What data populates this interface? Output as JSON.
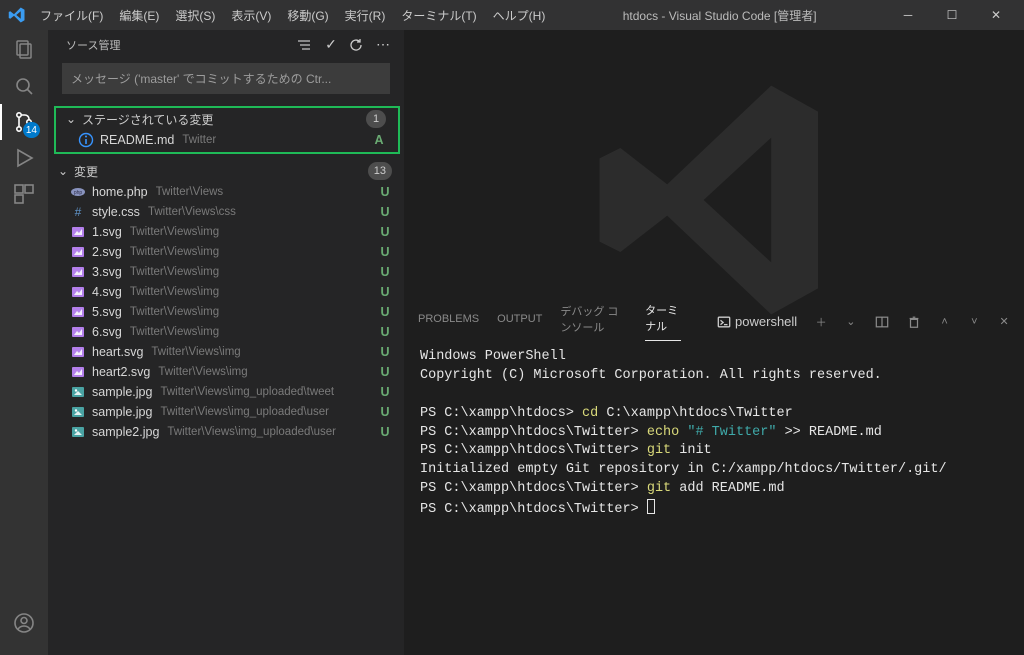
{
  "menubar": {
    "items": [
      "ファイル(F)",
      "編集(E)",
      "選択(S)",
      "表示(V)",
      "移動(G)",
      "実行(R)",
      "ターミナル(T)",
      "ヘルプ(H)"
    ],
    "title": "htdocs - Visual Studio Code [管理者]"
  },
  "activity": {
    "scm_badge": "14"
  },
  "scm": {
    "title": "ソース管理",
    "message_placeholder": "メッセージ ('master' でコミットするための Ctr...",
    "staged": {
      "label": "ステージされている変更",
      "count": "1",
      "files": [
        {
          "name": "README.md",
          "path": "Twitter",
          "status": "A",
          "icon": "info"
        }
      ]
    },
    "changes": {
      "label": "変更",
      "count": "13",
      "files": [
        {
          "name": "home.php",
          "path": "Twitter\\Views",
          "status": "U",
          "icon": "php"
        },
        {
          "name": "style.css",
          "path": "Twitter\\Views\\css",
          "status": "U",
          "icon": "css"
        },
        {
          "name": "1.svg",
          "path": "Twitter\\Views\\img",
          "status": "U",
          "icon": "svg"
        },
        {
          "name": "2.svg",
          "path": "Twitter\\Views\\img",
          "status": "U",
          "icon": "svg"
        },
        {
          "name": "3.svg",
          "path": "Twitter\\Views\\img",
          "status": "U",
          "icon": "svg"
        },
        {
          "name": "4.svg",
          "path": "Twitter\\Views\\img",
          "status": "U",
          "icon": "svg"
        },
        {
          "name": "5.svg",
          "path": "Twitter\\Views\\img",
          "status": "U",
          "icon": "svg"
        },
        {
          "name": "6.svg",
          "path": "Twitter\\Views\\img",
          "status": "U",
          "icon": "svg"
        },
        {
          "name": "heart.svg",
          "path": "Twitter\\Views\\img",
          "status": "U",
          "icon": "svg"
        },
        {
          "name": "heart2.svg",
          "path": "Twitter\\Views\\img",
          "status": "U",
          "icon": "svg"
        },
        {
          "name": "sample.jpg",
          "path": "Twitter\\Views\\img_uploaded\\tweet",
          "status": "U",
          "icon": "img"
        },
        {
          "name": "sample.jpg",
          "path": "Twitter\\Views\\img_uploaded\\user",
          "status": "U",
          "icon": "img"
        },
        {
          "name": "sample2.jpg",
          "path": "Twitter\\Views\\img_uploaded\\user",
          "status": "U",
          "icon": "img"
        }
      ]
    }
  },
  "panel": {
    "tabs": {
      "problems": "PROBLEMS",
      "output": "OUTPUT",
      "debug": "デバッグ コンソール",
      "terminal": "ターミナル"
    },
    "shell_label": "powershell"
  },
  "terminal": {
    "line1": "Windows PowerShell",
    "line2": "Copyright (C) Microsoft Corporation. All rights reserved.",
    "ps1": "PS C:\\xampp\\htdocs> ",
    "cmd1a": "cd ",
    "cmd1b": "C:\\xampp\\htdocs\\Twitter",
    "ps2": "PS C:\\xampp\\htdocs\\Twitter> ",
    "cmd2a": "echo ",
    "cmd2b": "\"# Twitter\"",
    "cmd2c": " >> README.md",
    "cmd3a": "git ",
    "cmd3b": "init",
    "init_out": "Initialized empty Git repository in C:/xampp/htdocs/Twitter/.git/",
    "cmd4a": "git ",
    "cmd4b": "add README.md"
  }
}
